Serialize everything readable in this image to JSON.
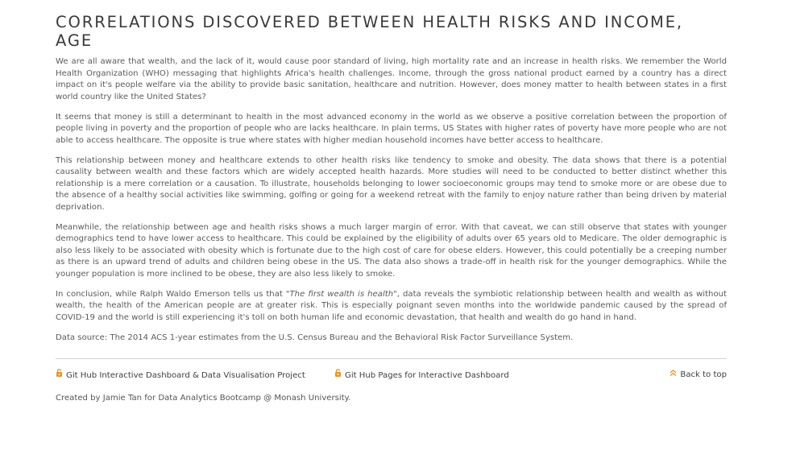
{
  "title": "CORRELATIONS DISCOVERED BETWEEN HEALTH RISKS AND INCOME, AGE",
  "paragraphs": [
    "We are all aware that wealth, and the lack of it, would cause poor standard of living, high mortality rate and an increase in health risks. We remember the World Health Organization (WHO) messaging that highlights Africa's health challenges. Income, through the gross national product earned by a country has a direct impact on it's people welfare via the ability to provide basic sanitation, healthcare and nutrition. However, does money matter to health between states in a first world country like the United States?",
    "It seems that money is still a determinant to health in the most advanced economy in the world as we observe a positive correlation between the proportion of people living in poverty and the proportion of people who are lacks healthcare. In plain terms, US States with higher rates of poverty have more people who are not able to access healthcare. The opposite is true where states with higher median household incomes have better access to healthcare.",
    "This relationship between money and healthcare extends to other health risks like tendency to smoke and obesity. The data shows that there is a potential causality between wealth and these factors which are widely accepted health hazards. More studies will need to be conducted to better distinct whether this relationship is a mere correlation or a causation. To illustrate, households belonging to lower socioeconomic groups may tend to smoke more or are obese due to the absence of a healthy social activities like swimming, golfing or going for a weekend retreat with the family to enjoy nature rather than being driven by material deprivation.",
    "Meanwhile, the relationship between age and health risks shows a much larger margin of error. With that caveat, we can still observe that states with younger demographics tend to have lower access to healthcare. This could be explained by the eligibility of adults over 65 years old to Medicare. The older demographic is also less likely to be associated with obesity which is fortunate due to the high cost of care for obese elders. However, this could potentially be a creeping number as there is an upward trend of adults and children being obese in the US. The data also shows a trade-off in health risk for the younger demographics. While the younger population is more inclined to be obese, they are also less likely to smoke."
  ],
  "conclusion": {
    "before": "In conclusion, while Ralph Waldo Emerson tells us that ",
    "quote": "\"The first wealth is health\"",
    "after": ", data reveals the symbiotic relationship between health and wealth as without wealth, the health of the American people are at greater risk. This is especially poignant seven months into the worldwide pandemic caused by the spread of COVID-19 and the world is still experiencing it's toll on both human life and economic devastation, that health and wealth do go hand in hand."
  },
  "data_source": "Data source: The 2014 ACS 1-year estimates from the U.S. Census Bureau and the Behavioral Risk Factor Surveillance System.",
  "footer": {
    "link1": "Git Hub Interactive Dashboard & Data Visualisation Project",
    "link2": "Git Hub Pages for Interactive Dashboard",
    "back_to_top": "Back to top",
    "icon_github": "github-icon",
    "icon_up": "double-chevron-up-icon",
    "accent_color": "#e8952c"
  },
  "credit": "Created by Jamie Tan for Data Analytics Bootcamp @ Monash University."
}
